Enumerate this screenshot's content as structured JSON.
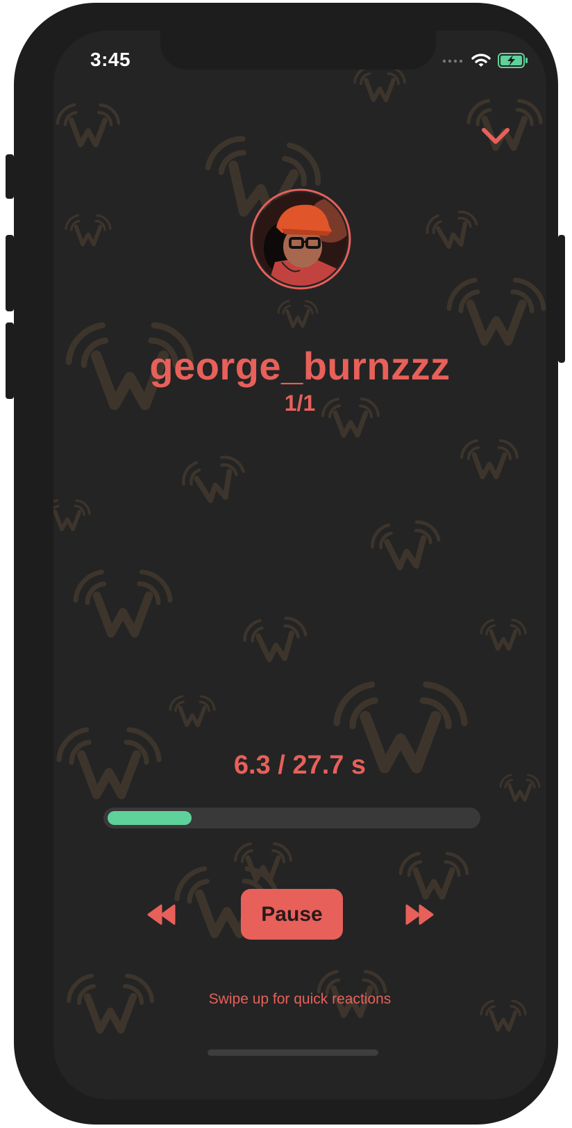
{
  "status_bar": {
    "time": "3:45",
    "signal_icon": "cellular-dots-icon",
    "wifi_icon": "wifi-icon",
    "battery_icon": "battery-charging-icon"
  },
  "header": {
    "collapse_icon": "chevron-down-icon"
  },
  "profile": {
    "username": "george_burnzzz",
    "position": "1/1",
    "avatar_icon": "avatar-photo"
  },
  "playback": {
    "elapsed_seconds": 6.3,
    "total_seconds": 27.7,
    "readout": "6.3 / 27.7 s",
    "progress_fraction": 0.227
  },
  "controls": {
    "rewind_icon": "rewind-icon",
    "pause_label": "Pause",
    "forward_icon": "fast-forward-icon"
  },
  "footer": {
    "hint": "Swipe up for quick reactions"
  },
  "colors": {
    "accent": "#e8605a",
    "progress": "#5fd19a",
    "background": "#242424",
    "watermark": "#3d352c"
  }
}
